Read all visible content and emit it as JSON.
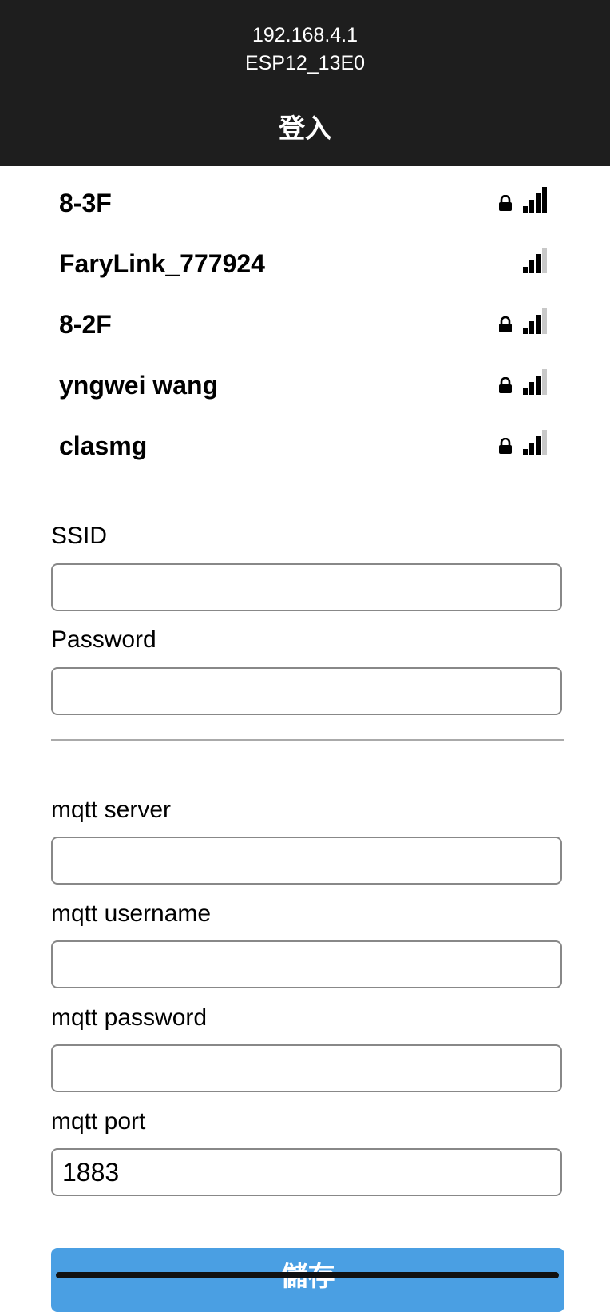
{
  "header": {
    "ip": "192.168.4.1",
    "ssid": "ESP12_13E0",
    "title": "登入"
  },
  "networks": [
    {
      "name": "8-3F",
      "locked": true,
      "signal_bars": 4
    },
    {
      "name": "FaryLink_777924",
      "locked": false,
      "signal_bars": 3
    },
    {
      "name": "8-2F",
      "locked": true,
      "signal_bars": 3
    },
    {
      "name": "yngwei wang",
      "locked": true,
      "signal_bars": 3
    },
    {
      "name": "clasmg",
      "locked": true,
      "signal_bars": 3
    }
  ],
  "form": {
    "ssid_label": "SSID",
    "ssid_value": "",
    "password_label": "Password",
    "password_value": "",
    "mqtt_server_label": "mqtt server",
    "mqtt_server_value": "",
    "mqtt_username_label": "mqtt username",
    "mqtt_username_value": "",
    "mqtt_password_label": "mqtt password",
    "mqtt_password_value": "",
    "mqtt_port_label": "mqtt port",
    "mqtt_port_value": "1883"
  },
  "save_label": "儲存",
  "colors": {
    "header_bg": "#1e1e1e",
    "button_bg": "#4a9fe3"
  }
}
